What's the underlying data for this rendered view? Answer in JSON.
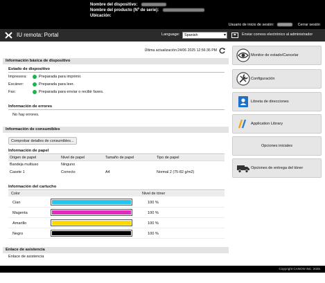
{
  "header": {
    "device_name_label": "Nombre del dispositivo:",
    "product_name_label": "Nombre del producto (Nº de serie):",
    "location_label": "Ubicación:",
    "login_user_label": "Usuario de inicio de sesión:",
    "logout_label": "Cerrar sesión"
  },
  "bar": {
    "title": "IU remota: Portal",
    "language_label": "Language:",
    "language_value": "Spanish",
    "mail_label": "Enviar correos electrónico al administrador"
  },
  "main": {
    "last_update": "Última actualización:24/06 2025 12:56:36 PM",
    "basic_info_title": "Información básica de dispositivo",
    "device_status_title": "Estado de dispositivo",
    "status": [
      {
        "device": "Impresora:",
        "text": "Preparada para imprimir."
      },
      {
        "device": "Escáner:",
        "text": "Preparada para leer."
      },
      {
        "device": "Fax:",
        "text": "Preparada para enviar o recibir faxes."
      }
    ],
    "error_title": "Información de errores",
    "error_text": "No hay errores.",
    "consumables_title": "Información de consumibles",
    "check_button": "Comprobar detalles de consumibles...",
    "paper_title": "Información de papel",
    "paper_columns": [
      "Origen de papel",
      "Nivel de papel",
      "Tamaño de papel",
      "Tipo de papel"
    ],
    "paper_rows": [
      [
        "Bandeja multiuso",
        "Ninguno",
        "",
        ""
      ],
      [
        "Casete 1",
        "Correcto",
        "A4",
        "Normal 2 (75-82 g/m2)"
      ]
    ],
    "cartridge_title": "Información del cartucho",
    "toner_columns": [
      "Color",
      "Nivel de tóner"
    ],
    "toners": [
      {
        "name": "Cian",
        "level": "100 %",
        "pct": 1.0,
        "color": "#22c6f0"
      },
      {
        "name": "Magenta",
        "level": "100 %",
        "pct": 1.0,
        "color": "#e02bbd"
      },
      {
        "name": "Amarillo",
        "level": "100 %",
        "pct": 1.0,
        "color": "#ffd800"
      },
      {
        "name": "Negro",
        "level": "100 %",
        "pct": 1.0,
        "color": "#000000"
      }
    ],
    "support_title": "Enlace de asistencia",
    "support_text": "Enlace de asistencia"
  },
  "nav": {
    "monitor": "Monitor de estado/Cancelar",
    "settings": "Configuración",
    "address_book": "Libreta de direcciones",
    "app_library": "Application Library",
    "initial_options": "Opciones iniciales",
    "toner_delivery": "Opciones de entrega del tóner"
  },
  "footer": {
    "copyright": "Copyright CANON INC. 2025"
  }
}
